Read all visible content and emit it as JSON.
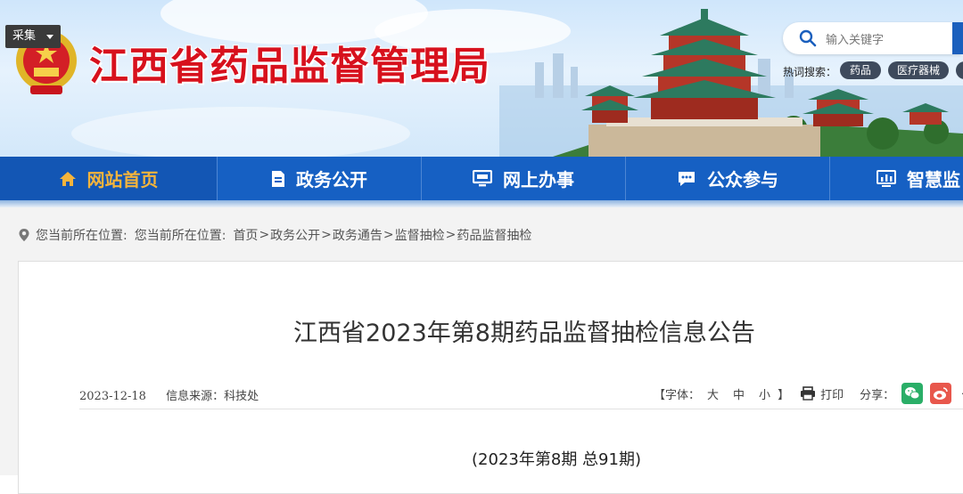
{
  "header": {
    "collect_label": "采集",
    "site_title": "江西省药品监督管理局",
    "search": {
      "placeholder": "输入关键字"
    },
    "hot_label": "热词搜索：",
    "hot_tags": [
      "药品",
      "医疗器械"
    ]
  },
  "nav": {
    "items": [
      {
        "label": "网站首页",
        "icon": "home-icon",
        "active": true
      },
      {
        "label": "政务公开",
        "icon": "document-icon"
      },
      {
        "label": "网上办事",
        "icon": "monitor-icon"
      },
      {
        "label": "公众参与",
        "icon": "chat-icon"
      },
      {
        "label": "智慧监",
        "icon": "dashboard-icon"
      }
    ]
  },
  "breadcrumb": {
    "prefix": "您当前所在位置:",
    "prefix2": "您当前所在位置:",
    "items": [
      "首页",
      "政务公开",
      "政务通告",
      "监督抽检",
      "药品监督抽检"
    ],
    "separator": ">"
  },
  "article": {
    "title": "江西省2023年第8期药品监督抽检信息公告",
    "date": "2023-12-18",
    "source": "信息来源：科技处",
    "font_label_open": "【字体：",
    "font_sizes": [
      "大",
      "中",
      "小"
    ],
    "font_label_close": "】",
    "print_label": "打印",
    "share_label": "分享：",
    "share_more": "+",
    "issue_line": "(2023年第8期 总91期)"
  },
  "colors": {
    "title_red": "#d7111d",
    "nav_blue": "#1660c3",
    "nav_active_text": "#f4b43c",
    "wechat_green": "#2aae67",
    "weibo_red": "#e8574c"
  }
}
